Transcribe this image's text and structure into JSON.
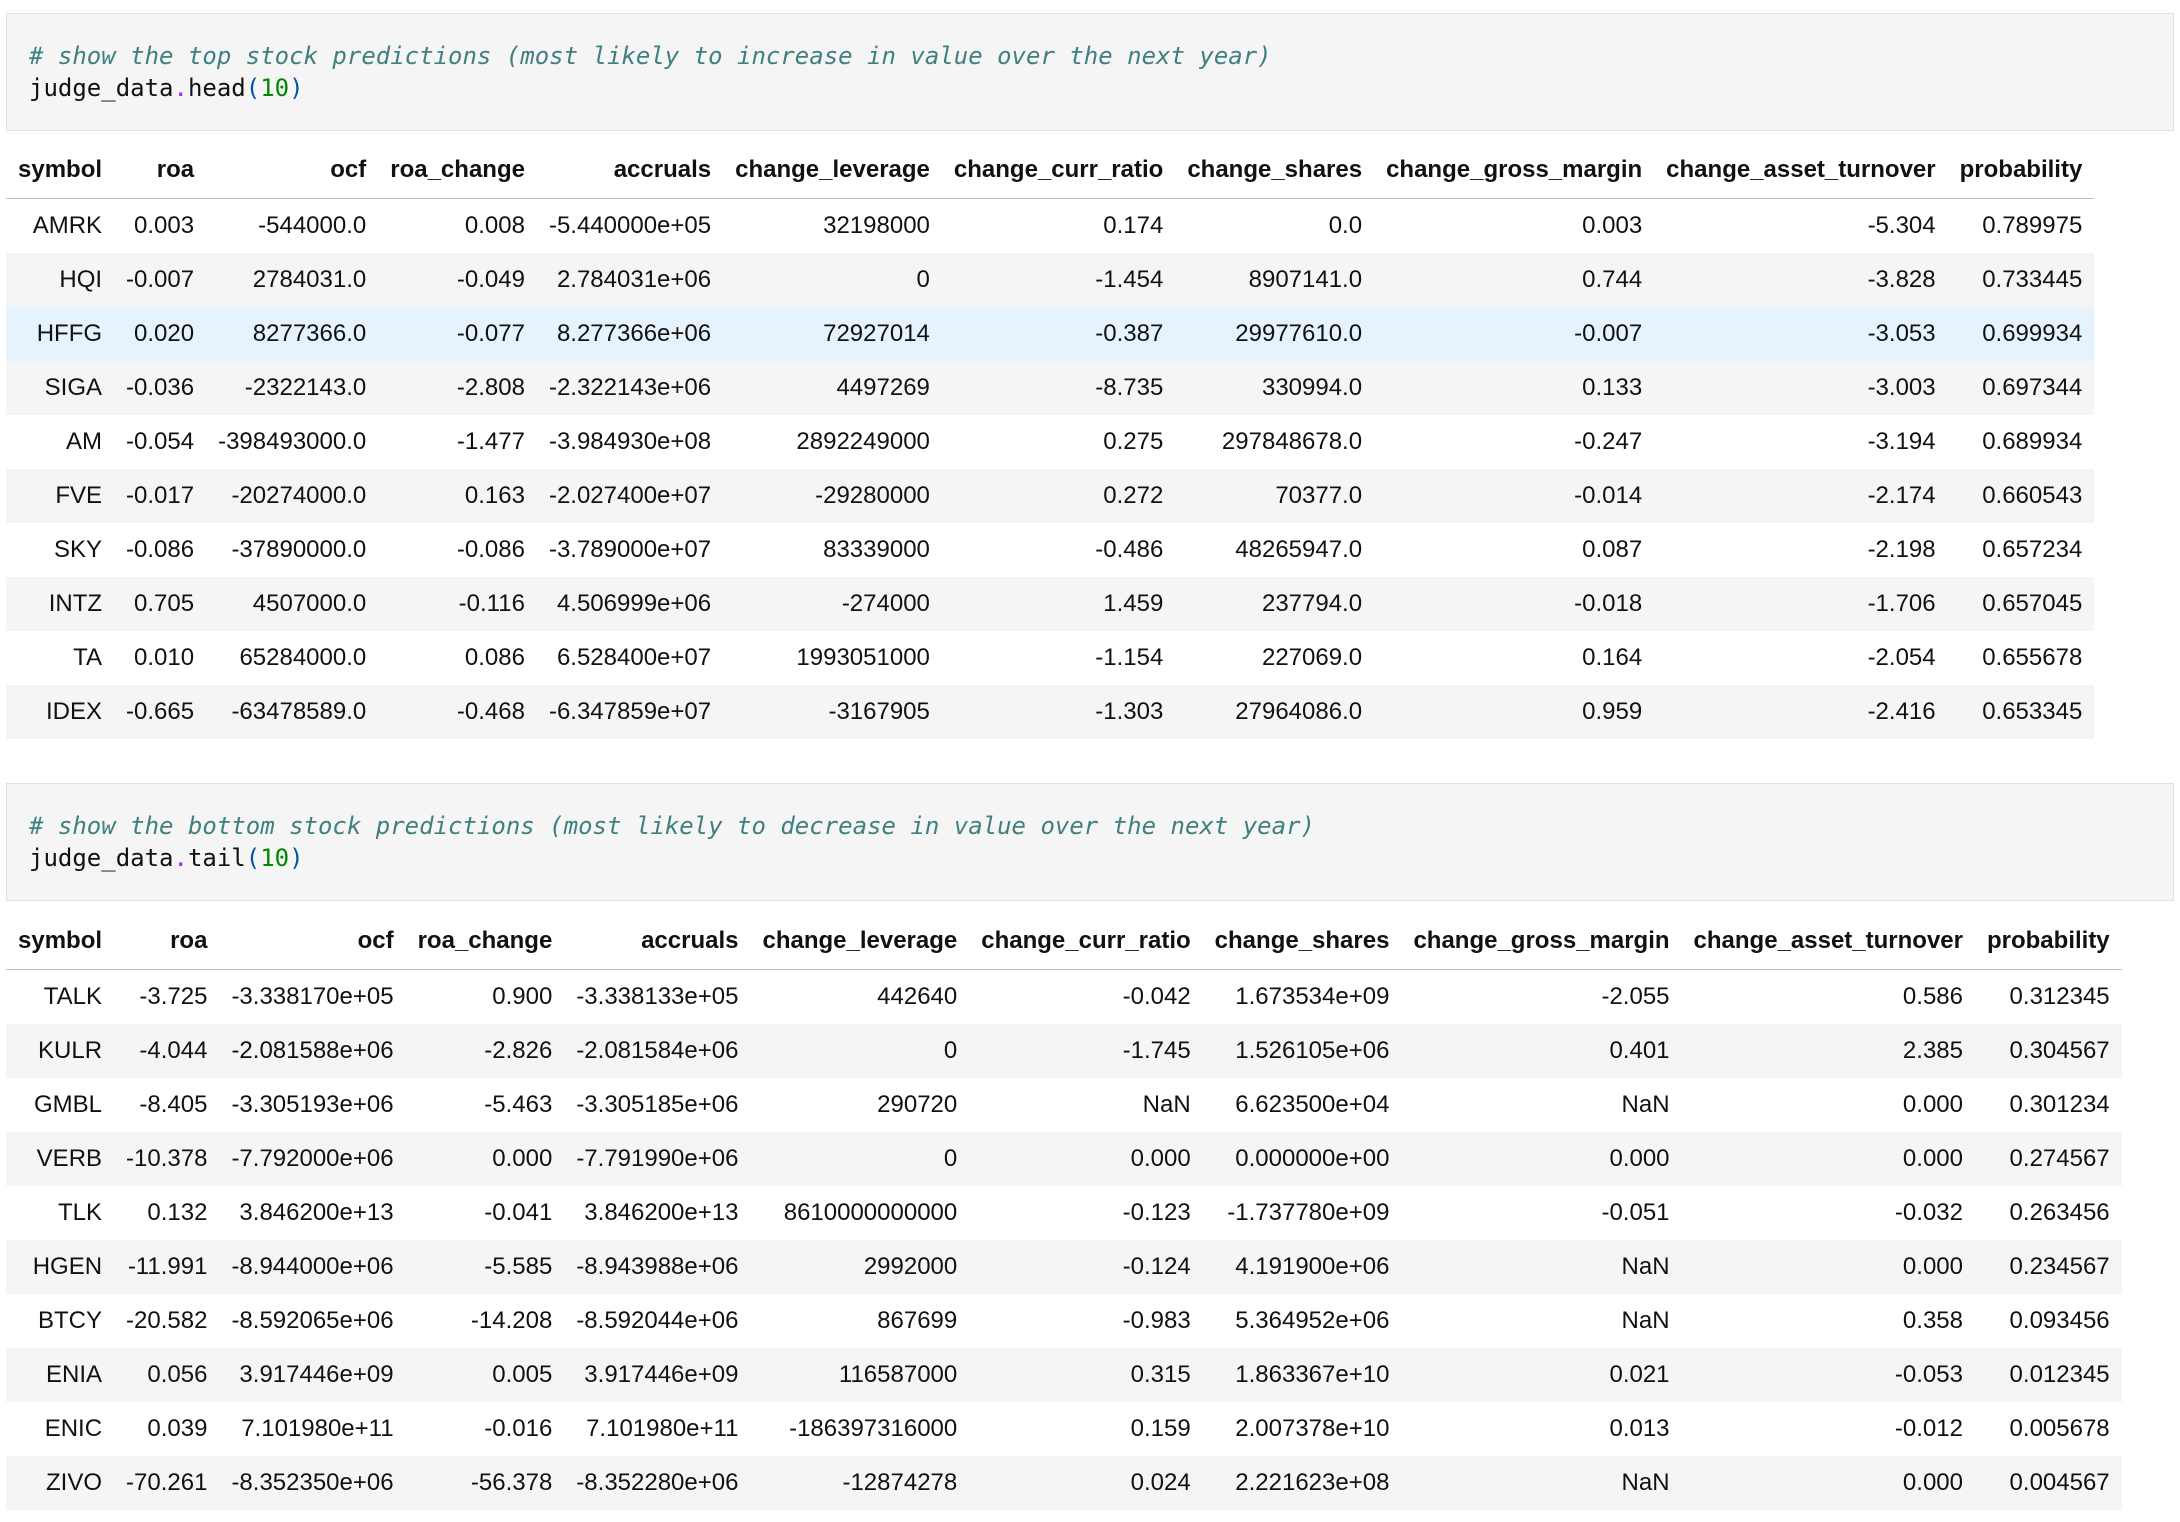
{
  "cell1": {
    "comment": "# show the top stock predictions (most likely to increase in value over the next year)",
    "code_obj": "judge_data",
    "code_dot": ".",
    "code_fn": "head",
    "code_open": "(",
    "code_arg": "10",
    "code_close": ")"
  },
  "table1": {
    "columns": [
      "symbol",
      "roa",
      "ocf",
      "roa_change",
      "accruals",
      "change_leverage",
      "change_curr_ratio",
      "change_shares",
      "change_gross_margin",
      "change_asset_turnover",
      "probability"
    ],
    "rows": [
      [
        "AMRK",
        "0.003",
        "-544000.0",
        "0.008",
        "-5.440000e+05",
        "32198000",
        "0.174",
        "0.0",
        "0.003",
        "-5.304",
        "0.789975"
      ],
      [
        "HQI",
        "-0.007",
        "2784031.0",
        "-0.049",
        "2.784031e+06",
        "0",
        "-1.454",
        "8907141.0",
        "0.744",
        "-3.828",
        "0.733445"
      ],
      [
        "HFFG",
        "0.020",
        "8277366.0",
        "-0.077",
        "8.277366e+06",
        "72927014",
        "-0.387",
        "29977610.0",
        "-0.007",
        "-3.053",
        "0.699934"
      ],
      [
        "SIGA",
        "-0.036",
        "-2322143.0",
        "-2.808",
        "-2.322143e+06",
        "4497269",
        "-8.735",
        "330994.0",
        "0.133",
        "-3.003",
        "0.697344"
      ],
      [
        "AM",
        "-0.054",
        "-398493000.0",
        "-1.477",
        "-3.984930e+08",
        "2892249000",
        "0.275",
        "297848678.0",
        "-0.247",
        "-3.194",
        "0.689934"
      ],
      [
        "FVE",
        "-0.017",
        "-20274000.0",
        "0.163",
        "-2.027400e+07",
        "-29280000",
        "0.272",
        "70377.0",
        "-0.014",
        "-2.174",
        "0.660543"
      ],
      [
        "SKY",
        "-0.086",
        "-37890000.0",
        "-0.086",
        "-3.789000e+07",
        "83339000",
        "-0.486",
        "48265947.0",
        "0.087",
        "-2.198",
        "0.657234"
      ],
      [
        "INTZ",
        "0.705",
        "4507000.0",
        "-0.116",
        "4.506999e+06",
        "-274000",
        "1.459",
        "237794.0",
        "-0.018",
        "-1.706",
        "0.657045"
      ],
      [
        "TA",
        "0.010",
        "65284000.0",
        "0.086",
        "6.528400e+07",
        "1993051000",
        "-1.154",
        "227069.0",
        "0.164",
        "-2.054",
        "0.655678"
      ],
      [
        "IDEX",
        "-0.665",
        "-63478589.0",
        "-0.468",
        "-6.347859e+07",
        "-3167905",
        "-1.303",
        "27964086.0",
        "0.959",
        "-2.416",
        "0.653345"
      ]
    ]
  },
  "cell2": {
    "comment": "# show the bottom stock predictions (most likely to decrease in value over the next year)",
    "code_obj": "judge_data",
    "code_dot": ".",
    "code_fn": "tail",
    "code_open": "(",
    "code_arg": "10",
    "code_close": ")"
  },
  "table2": {
    "columns": [
      "symbol",
      "roa",
      "ocf",
      "roa_change",
      "accruals",
      "change_leverage",
      "change_curr_ratio",
      "change_shares",
      "change_gross_margin",
      "change_asset_turnover",
      "probability"
    ],
    "rows": [
      [
        "TALK",
        "-3.725",
        "-3.338170e+05",
        "0.900",
        "-3.338133e+05",
        "442640",
        "-0.042",
        "1.673534e+09",
        "-2.055",
        "0.586",
        "0.312345"
      ],
      [
        "KULR",
        "-4.044",
        "-2.081588e+06",
        "-2.826",
        "-2.081584e+06",
        "0",
        "-1.745",
        "1.526105e+06",
        "0.401",
        "2.385",
        "0.304567"
      ],
      [
        "GMBL",
        "-8.405",
        "-3.305193e+06",
        "-5.463",
        "-3.305185e+06",
        "290720",
        "NaN",
        "6.623500e+04",
        "NaN",
        "0.000",
        "0.301234"
      ],
      [
        "VERB",
        "-10.378",
        "-7.792000e+06",
        "0.000",
        "-7.791990e+06",
        "0",
        "0.000",
        "0.000000e+00",
        "0.000",
        "0.000",
        "0.274567"
      ],
      [
        "TLK",
        "0.132",
        "3.846200e+13",
        "-0.041",
        "3.846200e+13",
        "8610000000000",
        "-0.123",
        "-1.737780e+09",
        "-0.051",
        "-0.032",
        "0.263456"
      ],
      [
        "HGEN",
        "-11.991",
        "-8.944000e+06",
        "-5.585",
        "-8.943988e+06",
        "2992000",
        "-0.124",
        "4.191900e+06",
        "NaN",
        "0.000",
        "0.234567"
      ],
      [
        "BTCY",
        "-20.582",
        "-8.592065e+06",
        "-14.208",
        "-8.592044e+06",
        "867699",
        "-0.983",
        "5.364952e+06",
        "NaN",
        "0.358",
        "0.093456"
      ],
      [
        "ENIA",
        "0.056",
        "3.917446e+09",
        "0.005",
        "3.917446e+09",
        "116587000",
        "0.315",
        "1.863367e+10",
        "0.021",
        "-0.053",
        "0.012345"
      ],
      [
        "ENIC",
        "0.039",
        "7.101980e+11",
        "-0.016",
        "7.101980e+11",
        "-186397316000",
        "0.159",
        "2.007378e+10",
        "0.013",
        "-0.012",
        "0.005678"
      ],
      [
        "ZIVO",
        "-70.261",
        "-8.352350e+06",
        "-56.378",
        "-8.352280e+06",
        "-12874278",
        "0.024",
        "2.221623e+08",
        "NaN",
        "0.000",
        "0.004567"
      ]
    ]
  }
}
